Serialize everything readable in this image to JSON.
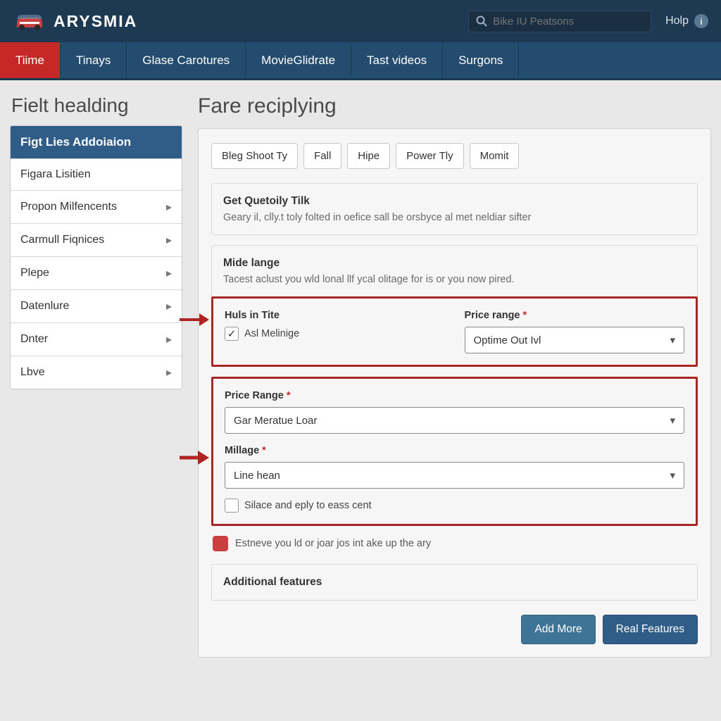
{
  "header": {
    "brand": "ARYSMIA",
    "search_placeholder": "Bike IU Peatsons",
    "help_label": "Holp"
  },
  "nav": {
    "items": [
      {
        "label": "Tiime",
        "active": true
      },
      {
        "label": "Tinays"
      },
      {
        "label": "Glase Carotures"
      },
      {
        "label": "MovieGlidrate"
      },
      {
        "label": "Tast videos"
      },
      {
        "label": "Surgons"
      }
    ]
  },
  "left": {
    "heading": "Fielt healding",
    "menu_header": "Figt Lies Addoiaion",
    "menu_items": [
      {
        "label": "Figara Lisitien",
        "arrow": false
      },
      {
        "label": "Propon Milfencents",
        "arrow": true
      },
      {
        "label": "Carmull Fiqnices",
        "arrow": true
      },
      {
        "label": "Plepe",
        "arrow": true
      },
      {
        "label": "Datenlure",
        "arrow": true
      },
      {
        "label": "Dnter",
        "arrow": true
      },
      {
        "label": "Lbve",
        "arrow": true
      }
    ]
  },
  "main": {
    "heading": "Fare reciplying",
    "pills": [
      "Bleg Shoot Ty",
      "Fall",
      "Hipe",
      "Power Tly",
      "Momit"
    ],
    "sec1": {
      "title": "Get Quetoily Tilk",
      "desc": "Geary il, clly.t toly folted in oefice sall be orsbyce al met neldiar sifter"
    },
    "sec2": {
      "title": "Mide lange",
      "desc": "Tacest aclust you wld lonal llf ycal olitage for is or you now pired."
    },
    "hl1": {
      "left_label": "Huls in Tite",
      "left_check": "Asl Melinige",
      "right_label": "Price range",
      "right_value": "Optime Out Ivl"
    },
    "hl2": {
      "label1": "Price Range",
      "value1": "Gar Meratue Loar",
      "label2": "Millage",
      "value2": "Line hean",
      "check_label": "Silace and eply to eass cent"
    },
    "note": "Estneve you ld or joar jos int ake up the ary",
    "features_title": "Additional features",
    "btn_more": "Add More",
    "btn_feat": "Real Features"
  }
}
